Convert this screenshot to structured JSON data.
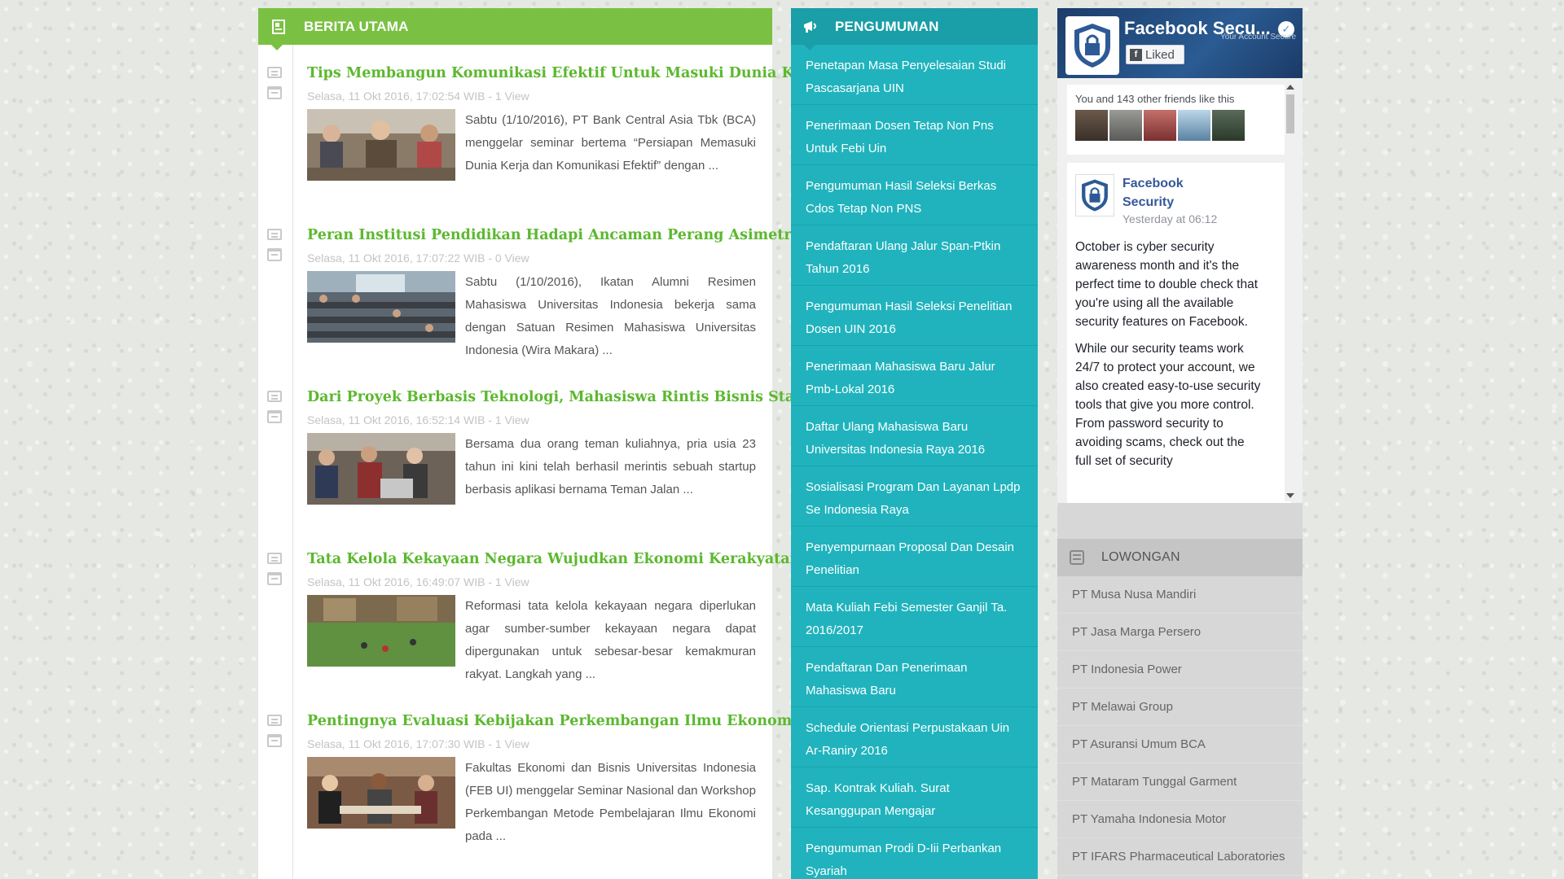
{
  "news": {
    "title": "BERITA UTAMA",
    "articles": [
      {
        "title": "Tips Membangun Komunikasi Efektif Untuk Masuki Dunia Kerja",
        "meta": "Selasa, 11 Okt 2016, 17:02:54 WIB - 1 View",
        "excerpt": "Sabtu (1/10/2016), PT Bank Central Asia Tbk (BCA) menggelar seminar bertema “Persiapan Memasuki Dunia Kerja dan Komunikasi Efektif” dengan ..."
      },
      {
        "title": "Peran Institusi Pendidikan Hadapi Ancaman Perang Asimetris",
        "meta": "Selasa, 11 Okt 2016, 17:07:22 WIB - 0 View",
        "excerpt": "Sabtu (1/10/2016), Ikatan Alumni Resimen Mahasiswa Universitas Indonesia bekerja sama dengan Satuan Resimen Mahasiswa Universitas Indonesia (Wira Makara) ..."
      },
      {
        "title": "Dari Proyek Berbasis Teknologi, Mahasiswa Rintis Bisnis Startup",
        "meta": "Selasa, 11 Okt 2016, 16:52:14 WIB - 1 View",
        "excerpt": "Bersama dua orang teman kuliahnya, pria usia 23 tahun ini kini telah berhasil merintis sebuah startup berbasis aplikasi bernama Teman Jalan ..."
      },
      {
        "title": "Tata Kelola Kekayaan Negara Wujudkan Ekonomi Kerakyatan",
        "meta": "Selasa, 11 Okt 2016, 16:49:07 WIB - 1 View",
        "excerpt": "Reformasi tata kelola kekayaan negara diperlukan agar sumber-sumber kekayaan negara dapat dipergunakan untuk sebesar-besar kemakmuran rakyat. Langkah yang ..."
      },
      {
        "title": "Pentingnya Evaluasi Kebijakan Perkembangan Ilmu Ekonomi",
        "meta": "Selasa, 11 Okt 2016, 17:07:30 WIB - 1 View",
        "excerpt": "Fakultas Ekonomi dan Bisnis Universitas Indonesia (FEB UI) menggelar Seminar Nasional dan Workshop Perkembangan Metode Pembelajaran Ilmu Ekonomi pada ..."
      }
    ]
  },
  "announcements": {
    "title": "PENGUMUMAN",
    "items": [
      "Penetapan Masa Penyelesaian Studi Pascasarjana UIN",
      "Penerimaan Dosen Tetap Non Pns Untuk Febi Uin",
      "Pengumuman Hasil Seleksi Berkas Cdos Tetap Non PNS",
      "Pendaftaran Ulang Jalur Span-Ptkin Tahun 2016",
      "Pengumuman Hasil Seleksi Penelitian Dosen UIN 2016",
      "Penerimaan Mahasiswa Baru Jalur Pmb-Lokal 2016",
      "Daftar Ulang Mahasiswa Baru Universitas Indonesia Raya 2016",
      "Sosialisasi Program Dan Layanan Lpdp Se Indonesia Raya",
      "Penyempurnaan Proposal Dan Desain Penelitian",
      "Mata Kuliah Febi Semester Ganjil Ta. 2016/2017",
      "Pendaftaran Dan Penerimaan Mahasiswa Baru",
      "Schedule Orientasi Perpustakaan Uin Ar-Raniry 2016",
      "Sap. Kontrak Kuliah. Surat Kesanggupan Mengajar",
      "Pengumuman Prodi D-Iii Perbankan Syariah"
    ]
  },
  "facebook": {
    "page_name": "Facebook Secu...",
    "liked_label": "Liked",
    "tagline": "Your Account Secure",
    "friends_text": "You and 143 other friends like this",
    "post": {
      "author": "Facebook Security",
      "time": "Yesterday at 06:12",
      "paragraph1": "October is cyber security awareness month and it's the perfect time to double check that you're using all the available security features on Facebook.",
      "paragraph2": "While our security teams work 24/7 to protect your account, we also created easy-to-use security tools that give you more control. From password security to avoiding scams, check out the full set of security"
    }
  },
  "jobs": {
    "title": "LOWONGAN",
    "items": [
      "PT Musa Nusa Mandiri",
      "PT Jasa Marga Persero",
      "PT Indonesia Power",
      "PT Melawai Group",
      "PT Asuransi Umum BCA",
      "PT Mataram Tunggal Garment",
      "PT Yamaha Indonesia Motor",
      "PT IFARS Pharmaceutical Laboratories"
    ]
  },
  "colors": {
    "news_header": "#7ac143",
    "news_title": "#5cb82f",
    "announce_bg": "#20b3bd",
    "announce_header": "#1a9ea7",
    "jobs_bg": "#d6d7d6"
  }
}
